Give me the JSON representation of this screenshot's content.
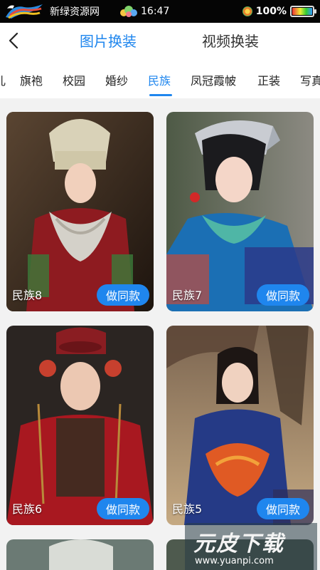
{
  "status_bar": {
    "app_name": "新绿资源网",
    "time": "16:47",
    "battery_percent": "100%",
    "battery_level": 1.0
  },
  "top_nav": {
    "tabs": [
      {
        "label": "图片换装",
        "active": true
      },
      {
        "label": "视频换装",
        "active": false
      }
    ]
  },
  "categories": [
    {
      "label": "旗袍",
      "active": false
    },
    {
      "label": "校园",
      "active": false
    },
    {
      "label": "婚纱",
      "active": false
    },
    {
      "label": "民族",
      "active": true
    },
    {
      "label": "凤冠霞帔",
      "active": false
    },
    {
      "label": "正装",
      "active": false
    },
    {
      "label": "写真",
      "active": false
    }
  ],
  "cards": [
    {
      "label": "民族8",
      "button": "做同款"
    },
    {
      "label": "民族7",
      "button": "做同款"
    },
    {
      "label": "民族6",
      "button": "做同款"
    },
    {
      "label": "民族5",
      "button": "做同款"
    }
  ],
  "watermark": {
    "title": "元皮下载",
    "url": "www.yuanpi.com"
  },
  "colors": {
    "accent": "#1f86ee",
    "status_bar": "#050505"
  }
}
